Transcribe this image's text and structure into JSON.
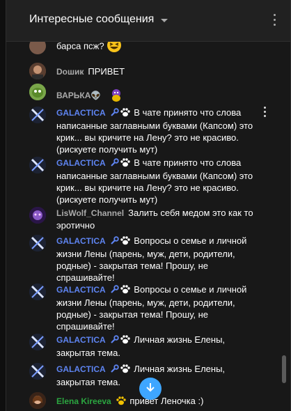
{
  "header": {
    "title": "Интересные сообщения"
  },
  "messages": [
    {
      "author": "",
      "text": "барса псж?",
      "emoji": "laughing-emoji"
    },
    {
      "author": "Dошик",
      "text": "ПРИВЕТ"
    },
    {
      "author": "ВАРЬКА👽",
      "text": "",
      "emoji": "dragon-emoji"
    },
    {
      "author": "GALACTICA",
      "text": "В чате принято что слова написанные заглавными буквами (Капсом) это крик... вы кричите на Лену? это не красиво. (рискуете получить мут)"
    },
    {
      "author": "GALACTICA",
      "text": "В чате принято что слова написанные заглавными буквами (Капсом) это крик... вы кричите на Лену? это не красиво. (рискуете получить мут)"
    },
    {
      "author": "LisWolf_Channel",
      "text": "Залить себя медом это как то эротично"
    },
    {
      "author": "GALACTICA",
      "text": "Вопросы о семье и личной жизни Лены (парень, муж, дети, родители, родные) - закрытая тема! Прошу, не спрашивайте!"
    },
    {
      "author": "GALACTICA",
      "text": "Вопросы о семье и личной жизни Лены (парень, муж, дети, родители, родные) - закрытая тема! Прошу, не спрашивайте!"
    },
    {
      "author": "GALACTICA",
      "text": "Личная жизнь Елены, закрытая тема."
    },
    {
      "author": "GALACTICA",
      "text": "Личная жизнь Елены, закрытая тема."
    },
    {
      "author": "Elena Kireeva",
      "text": "привет Леночка :)"
    }
  ],
  "colors": {
    "moderator": "#5e84f1",
    "owner": "#2ba640",
    "regular": "#aaaaaa",
    "accent": "#3ea6ff"
  },
  "icons": {
    "wrench": "wrench-icon",
    "paw": "paw-icon",
    "scroll": "arrow-down-icon"
  }
}
